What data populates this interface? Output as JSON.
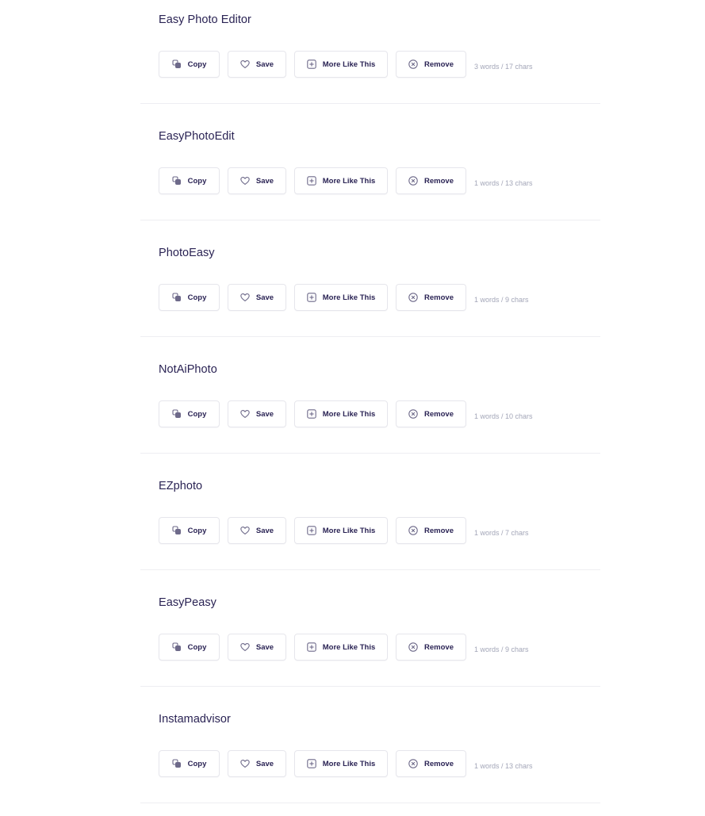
{
  "actions": {
    "copy_label": "Copy",
    "save_label": "Save",
    "more_label": "More Like This",
    "remove_label": "Remove",
    "icons": {
      "copy": "copy-icon",
      "save": "heart-icon",
      "more": "plus-square-icon",
      "remove": "x-circle-icon"
    }
  },
  "colors": {
    "text_primary": "#2a2354",
    "text_muted": "#a3a6b8",
    "icon": "#6e6a8a",
    "border": "#e6e6ec",
    "divider": "#eeeef2"
  },
  "names": [
    {
      "name": "Easy Photo Editor",
      "counts": "3 words / 17 chars"
    },
    {
      "name": "EasyPhotoEdit",
      "counts": "1 words / 13 chars"
    },
    {
      "name": "PhotoEasy",
      "counts": "1 words / 9 chars"
    },
    {
      "name": "NotAiPhoto",
      "counts": "1 words / 10 chars"
    },
    {
      "name": "EZphoto",
      "counts": "1 words / 7 chars"
    },
    {
      "name": "EasyPeasy",
      "counts": "1 words / 9 chars"
    },
    {
      "name": "Instamadvisor",
      "counts": "1 words / 13 chars"
    }
  ]
}
